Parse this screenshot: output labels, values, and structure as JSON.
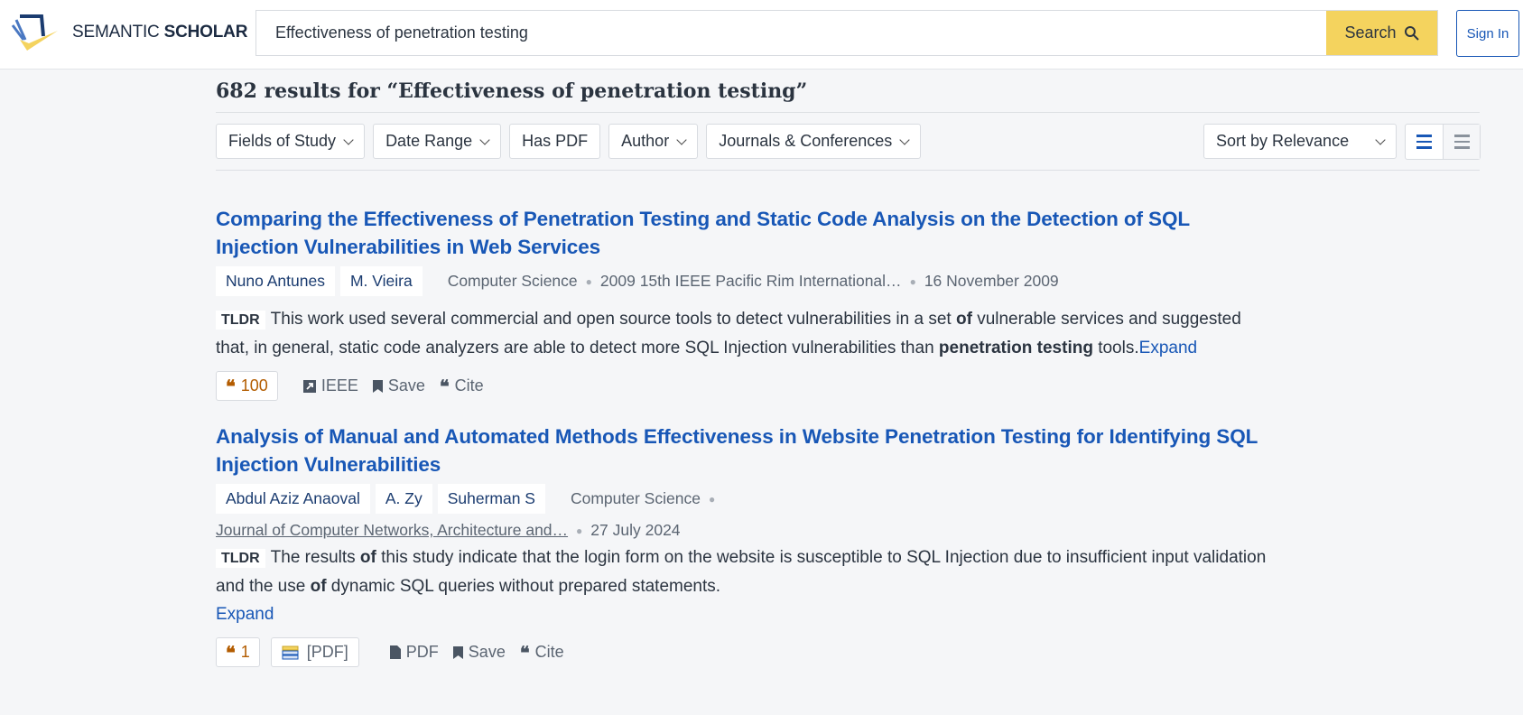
{
  "header": {
    "logo_light": "SEMANTIC",
    "logo_bold": "SCHOLAR",
    "search_value": "Effectiveness of penetration testing",
    "search_label": "Search",
    "signin_label": "Sign In"
  },
  "results_heading": "682 results for “Effectiveness of penetration testing”",
  "filters": [
    "Fields of Study",
    "Date Range",
    "Has PDF",
    "Author",
    "Journals & Conferences"
  ],
  "sort_label": "Sort by Relevance",
  "papers": [
    {
      "title": "Comparing the Effectiveness of Penetration Testing and Static Code Analysis on the Detection of SQL Injection Vulnerabilities in Web Services",
      "authors": [
        "Nuno Antunes",
        "M. Vieira"
      ],
      "field": "Computer Science",
      "venue": "2009 15th IEEE Pacific Rim International…",
      "date": "16 November 2009",
      "tldr_tag": "TLDR",
      "tldr_1": "This work used several commercial and open source tools to detect vulnerabilities in a set ",
      "tldr_b1": "of",
      "tldr_2": " vulnerable services and suggested that, in general, static code analyzers are able to detect more SQL Injection vulnerabilities than ",
      "tldr_b2": "penetration testing",
      "tldr_3": " tools.",
      "expand": "Expand",
      "citations": "100",
      "source": "IEEE",
      "save": "Save",
      "cite": "Cite"
    },
    {
      "title": "Analysis of Manual and Automated Methods Effectiveness in Website Penetration Testing for Identifying SQL Injection Vulnerabilities",
      "authors": [
        "Abdul Aziz Anaoval",
        "A. Zy",
        "Suherman S"
      ],
      "field": "Computer Science",
      "venue": "Journal of Computer Networks, Architecture and…",
      "date": "27 July 2024",
      "tldr_tag": "TLDR",
      "tldr_1": "The results ",
      "tldr_b1": "of",
      "tldr_2": " this study indicate that the login form on the website is susceptible to SQL Injection due to insufficient input validation and the use ",
      "tldr_b2": "of",
      "tldr_3": " dynamic SQL queries without prepared statements.",
      "expand": "Expand",
      "citations": "1",
      "pdf_badge": "[PDF]",
      "source": "PDF",
      "save": "Save",
      "cite": "Cite"
    }
  ]
}
